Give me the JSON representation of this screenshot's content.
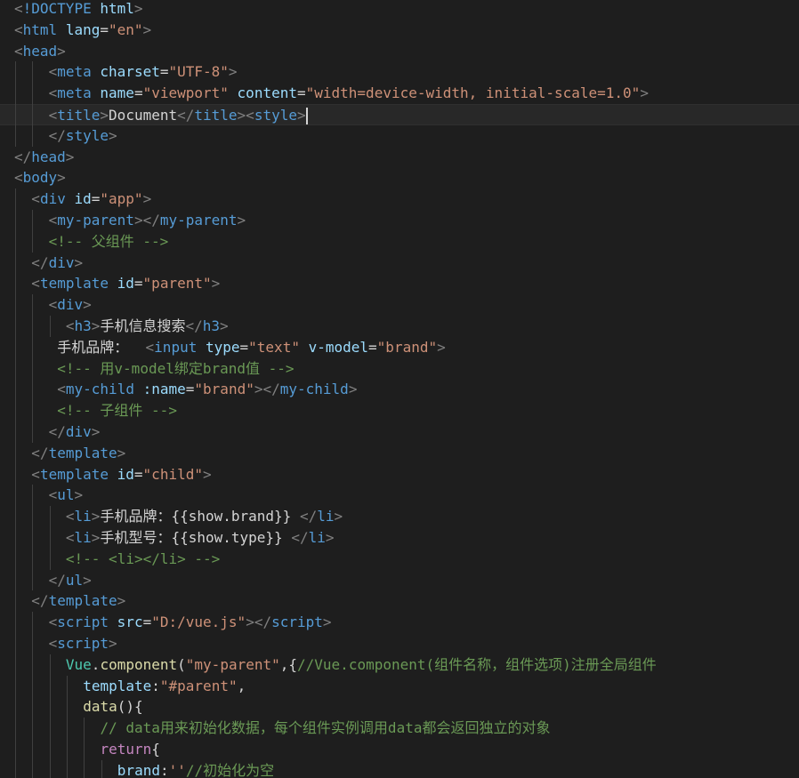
{
  "editor": {
    "cursor_line": 6,
    "lines": [
      {
        "indent": 0,
        "tokens": [
          [
            "bracket",
            "<"
          ],
          [
            "tag",
            "!DOCTYPE"
          ],
          [
            "text",
            " "
          ],
          [
            "attr",
            "html"
          ],
          [
            "bracket",
            ">"
          ]
        ]
      },
      {
        "indent": 0,
        "tokens": [
          [
            "bracket",
            "<"
          ],
          [
            "tag",
            "html"
          ],
          [
            "text",
            " "
          ],
          [
            "attr",
            "lang"
          ],
          [
            "text",
            "="
          ],
          [
            "str",
            "\"en\""
          ],
          [
            "bracket",
            ">"
          ]
        ]
      },
      {
        "indent": 0,
        "tokens": [
          [
            "bracket",
            "<"
          ],
          [
            "tag",
            "head"
          ],
          [
            "bracket",
            ">"
          ]
        ]
      },
      {
        "indent": 2,
        "tokens": [
          [
            "bracket",
            "<"
          ],
          [
            "tag",
            "meta"
          ],
          [
            "text",
            " "
          ],
          [
            "attr",
            "charset"
          ],
          [
            "text",
            "="
          ],
          [
            "str",
            "\"UTF-8\""
          ],
          [
            "bracket",
            ">"
          ]
        ]
      },
      {
        "indent": 2,
        "tokens": [
          [
            "bracket",
            "<"
          ],
          [
            "tag",
            "meta"
          ],
          [
            "text",
            " "
          ],
          [
            "attr",
            "name"
          ],
          [
            "text",
            "="
          ],
          [
            "str",
            "\"viewport\""
          ],
          [
            "text",
            " "
          ],
          [
            "attr",
            "content"
          ],
          [
            "text",
            "="
          ],
          [
            "str",
            "\"width=device-width, initial-scale=1.0\""
          ],
          [
            "bracket",
            ">"
          ]
        ]
      },
      {
        "indent": 2,
        "tokens": [
          [
            "bracket",
            "<"
          ],
          [
            "tag",
            "title"
          ],
          [
            "bracket",
            ">"
          ],
          [
            "text",
            "Document"
          ],
          [
            "bracket",
            "</"
          ],
          [
            "tag",
            "title"
          ],
          [
            "bracket",
            "><"
          ],
          [
            "tag",
            "style"
          ],
          [
            "bracket",
            ">"
          ]
        ],
        "cursor": true
      },
      {
        "indent": 2,
        "tokens": [
          [
            "bracket",
            "</"
          ],
          [
            "tag",
            "style"
          ],
          [
            "bracket",
            ">"
          ]
        ]
      },
      {
        "indent": 0,
        "tokens": [
          [
            "bracket",
            "</"
          ],
          [
            "tag",
            "head"
          ],
          [
            "bracket",
            ">"
          ]
        ]
      },
      {
        "indent": 0,
        "tokens": [
          [
            "bracket",
            "<"
          ],
          [
            "tag",
            "body"
          ],
          [
            "bracket",
            ">"
          ]
        ]
      },
      {
        "indent": 1,
        "tokens": [
          [
            "bracket",
            "<"
          ],
          [
            "tag",
            "div"
          ],
          [
            "text",
            " "
          ],
          [
            "attr",
            "id"
          ],
          [
            "text",
            "="
          ],
          [
            "str",
            "\"app\""
          ],
          [
            "bracket",
            ">"
          ]
        ]
      },
      {
        "indent": 2,
        "tokens": [
          [
            "bracket",
            "<"
          ],
          [
            "tag",
            "my-parent"
          ],
          [
            "bracket",
            "></"
          ],
          [
            "tag",
            "my-parent"
          ],
          [
            "bracket",
            ">"
          ]
        ]
      },
      {
        "indent": 2,
        "tokens": [
          [
            "comment",
            "<!-- 父组件 -->"
          ]
        ]
      },
      {
        "indent": 1,
        "tokens": [
          [
            "bracket",
            "</"
          ],
          [
            "tag",
            "div"
          ],
          [
            "bracket",
            ">"
          ]
        ]
      },
      {
        "indent": 1,
        "tokens": [
          [
            "bracket",
            "<"
          ],
          [
            "tag",
            "template"
          ],
          [
            "text",
            " "
          ],
          [
            "attr",
            "id"
          ],
          [
            "text",
            "="
          ],
          [
            "str",
            "\"parent\""
          ],
          [
            "bracket",
            ">"
          ]
        ]
      },
      {
        "indent": 2,
        "tokens": [
          [
            "bracket",
            "<"
          ],
          [
            "tag",
            "div"
          ],
          [
            "bracket",
            ">"
          ]
        ]
      },
      {
        "indent": 3,
        "tokens": [
          [
            "bracket",
            "<"
          ],
          [
            "tag",
            "h3"
          ],
          [
            "bracket",
            ">"
          ],
          [
            "text",
            "手机信息搜索"
          ],
          [
            "bracket",
            "</"
          ],
          [
            "tag",
            "h3"
          ],
          [
            "bracket",
            ">"
          ]
        ]
      },
      {
        "indent": 2.5,
        "tokens": [
          [
            "text",
            "手机品牌：  "
          ],
          [
            "bracket",
            "<"
          ],
          [
            "tag",
            "input"
          ],
          [
            "text",
            " "
          ],
          [
            "attr",
            "type"
          ],
          [
            "text",
            "="
          ],
          [
            "str",
            "\"text\""
          ],
          [
            "text",
            " "
          ],
          [
            "attr",
            "v-model"
          ],
          [
            "text",
            "="
          ],
          [
            "str",
            "\"brand\""
          ],
          [
            "bracket",
            ">"
          ]
        ]
      },
      {
        "indent": 2.5,
        "tokens": [
          [
            "comment",
            "<!-- 用v-model绑定brand值 -->"
          ]
        ]
      },
      {
        "indent": 2.5,
        "tokens": [
          [
            "bracket",
            "<"
          ],
          [
            "tag",
            "my-child"
          ],
          [
            "text",
            " "
          ],
          [
            "attr",
            ":name"
          ],
          [
            "text",
            "="
          ],
          [
            "str",
            "\"brand\""
          ],
          [
            "bracket",
            "></"
          ],
          [
            "tag",
            "my-child"
          ],
          [
            "bracket",
            ">"
          ]
        ]
      },
      {
        "indent": 2.5,
        "tokens": [
          [
            "comment",
            "<!-- 子组件 -->"
          ]
        ]
      },
      {
        "indent": 2,
        "tokens": [
          [
            "bracket",
            "</"
          ],
          [
            "tag",
            "div"
          ],
          [
            "bracket",
            ">"
          ]
        ]
      },
      {
        "indent": 1,
        "tokens": [
          [
            "bracket",
            "</"
          ],
          [
            "tag",
            "template"
          ],
          [
            "bracket",
            ">"
          ]
        ]
      },
      {
        "indent": 1,
        "tokens": [
          [
            "bracket",
            "<"
          ],
          [
            "tag",
            "template"
          ],
          [
            "text",
            " "
          ],
          [
            "attr",
            "id"
          ],
          [
            "text",
            "="
          ],
          [
            "str",
            "\"child\""
          ],
          [
            "bracket",
            ">"
          ]
        ]
      },
      {
        "indent": 2,
        "tokens": [
          [
            "bracket",
            "<"
          ],
          [
            "tag",
            "ul"
          ],
          [
            "bracket",
            ">"
          ]
        ]
      },
      {
        "indent": 3,
        "tokens": [
          [
            "bracket",
            "<"
          ],
          [
            "tag",
            "li"
          ],
          [
            "bracket",
            ">"
          ],
          [
            "text",
            "手机品牌：{{show.brand}} "
          ],
          [
            "bracket",
            "</"
          ],
          [
            "tag",
            "li"
          ],
          [
            "bracket",
            ">"
          ]
        ]
      },
      {
        "indent": 3,
        "tokens": [
          [
            "bracket",
            "<"
          ],
          [
            "tag",
            "li"
          ],
          [
            "bracket",
            ">"
          ],
          [
            "text",
            "手机型号：{{show.type}} "
          ],
          [
            "bracket",
            "</"
          ],
          [
            "tag",
            "li"
          ],
          [
            "bracket",
            ">"
          ]
        ]
      },
      {
        "indent": 3,
        "tokens": [
          [
            "comment",
            "<!-- <li></li> -->"
          ]
        ]
      },
      {
        "indent": 2,
        "tokens": [
          [
            "bracket",
            "</"
          ],
          [
            "tag",
            "ul"
          ],
          [
            "bracket",
            ">"
          ]
        ]
      },
      {
        "indent": 1,
        "tokens": [
          [
            "bracket",
            "</"
          ],
          [
            "tag",
            "template"
          ],
          [
            "bracket",
            ">"
          ]
        ]
      },
      {
        "indent": 2,
        "tokens": [
          [
            "bracket",
            "<"
          ],
          [
            "tag",
            "script"
          ],
          [
            "text",
            " "
          ],
          [
            "attr",
            "src"
          ],
          [
            "text",
            "="
          ],
          [
            "str",
            "\"D:/vue.js\""
          ],
          [
            "bracket",
            "></"
          ],
          [
            "tag",
            "script"
          ],
          [
            "bracket",
            ">"
          ]
        ]
      },
      {
        "indent": 2,
        "tokens": [
          [
            "bracket",
            "<"
          ],
          [
            "tag",
            "script"
          ],
          [
            "bracket",
            ">"
          ]
        ]
      },
      {
        "indent": 3,
        "tokens": [
          [
            "cls",
            "Vue"
          ],
          [
            "text",
            "."
          ],
          [
            "fn",
            "component"
          ],
          [
            "text",
            "("
          ],
          [
            "str",
            "\"my-parent\""
          ],
          [
            "text",
            ",{"
          ],
          [
            "comment",
            "//Vue.component(组件名称，组件选项)注册全局组件"
          ]
        ]
      },
      {
        "indent": 4,
        "tokens": [
          [
            "ident",
            "template"
          ],
          [
            "text",
            ":"
          ],
          [
            "str",
            "\"#parent\""
          ],
          [
            "text",
            ","
          ]
        ]
      },
      {
        "indent": 4,
        "tokens": [
          [
            "fn",
            "data"
          ],
          [
            "text",
            "(){"
          ]
        ]
      },
      {
        "indent": 5,
        "tokens": [
          [
            "comment",
            "// data用来初始化数据，每个组件实例调用data都会返回独立的对象"
          ]
        ]
      },
      {
        "indent": 5,
        "tokens": [
          [
            "kw",
            "return"
          ],
          [
            "text",
            "{"
          ]
        ]
      },
      {
        "indent": 6,
        "tokens": [
          [
            "ident",
            "brand"
          ],
          [
            "text",
            ":"
          ],
          [
            "str",
            "''"
          ],
          [
            "comment",
            "//初始化为空"
          ]
        ]
      }
    ]
  }
}
